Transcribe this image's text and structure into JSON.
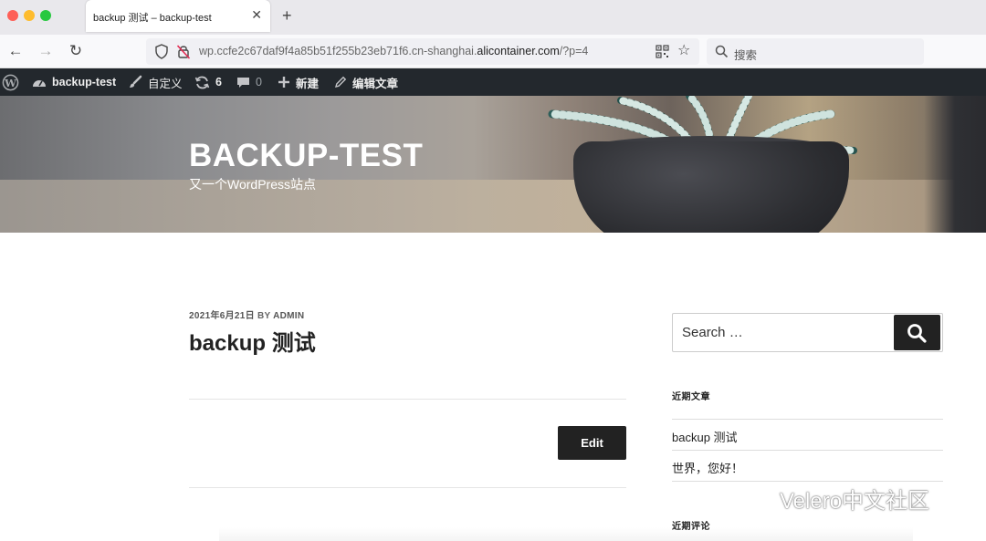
{
  "browser": {
    "tab_title": "backup 测试 – backup-test",
    "url_prefix": "wp.ccfe2c67daf9f4a85b51f255b23eb71f6.cn-shanghai.",
    "url_domain": "alicontainer.com",
    "url_suffix": "/?p=4",
    "search_placeholder": "搜索"
  },
  "adminbar": {
    "site_name": "backup-test",
    "customize": "自定义",
    "updates_count": "6",
    "comments_count": "0",
    "new_label": "新建",
    "edit_post": "编辑文章"
  },
  "header": {
    "site_title": "BACKUP-TEST",
    "site_description": "又一个WordPress站点"
  },
  "post": {
    "date": "2021年6月21日",
    "by_label": "BY",
    "author": "ADMIN",
    "title": "backup 测试",
    "edit_label": "Edit"
  },
  "sidebar": {
    "search_placeholder": "Search …",
    "recent_posts_title": "近期文章",
    "recent_posts": [
      "backup 测试",
      "世界，您好！"
    ],
    "recent_comments_title": "近期评论"
  },
  "watermark": {
    "text": "Velero中文社区"
  },
  "colors": {
    "adminbar_bg": "#23282d",
    "button_bg": "#222222"
  }
}
